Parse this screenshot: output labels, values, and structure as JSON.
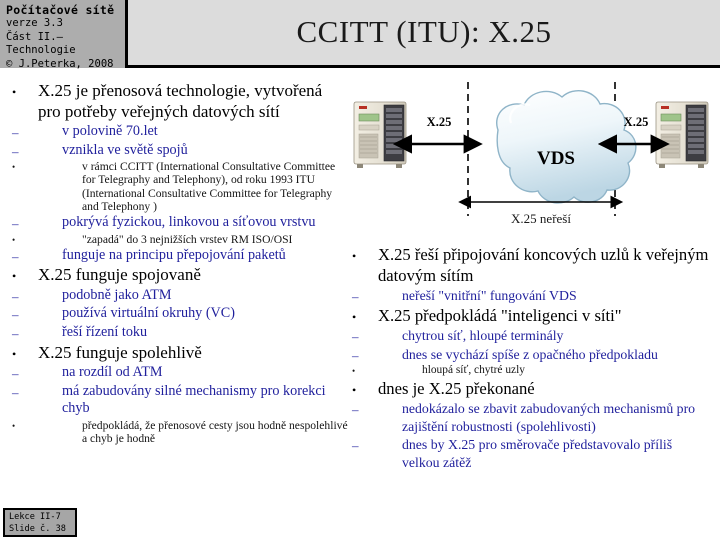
{
  "header": {
    "course_title": "Počítačové sítě",
    "version": "verze 3.3",
    "part": "Část II.–Technologie",
    "copyright": "© J.Peterka,  2008",
    "slide_title": "CCITT (ITU): X.25",
    "band_color": "#dcdcdc",
    "box_color": "#adadad"
  },
  "left_column": [
    {
      "level": 1,
      "bullet": "•",
      "text": "X.25 je přenosová technologie, vytvořená pro potřeby veřejných datových sítí"
    },
    {
      "level": 2,
      "bullet": "–",
      "text": "v polovině 70.let"
    },
    {
      "level": 2,
      "bullet": "–",
      "text": "vznikla ve světě spojů"
    },
    {
      "level": 3,
      "bullet": "•",
      "text": "v rámci CCITT (International Consultative Committee for Telegraphy and Telephony), od roku 1993 ITU (International Consultative Committee for Telegraphy and Telephony )"
    },
    {
      "level": 2,
      "bullet": "–",
      "text": "pokrývá fyzickou, linkovou a síťovou vrstvu"
    },
    {
      "level": 3,
      "bullet": "•",
      "text": "\"zapadá\" do 3 nejnižších vrstev RM ISO/OSI"
    },
    {
      "level": 2,
      "bullet": "–",
      "text": "funguje na principu přepojování paketů"
    },
    {
      "level": 1,
      "bullet": "•",
      "text": "X.25 funguje spojovaně"
    },
    {
      "level": 2,
      "bullet": "–",
      "text": "podobně jako ATM"
    },
    {
      "level": 2,
      "bullet": "–",
      "text": "používá virtuální okruhy (VC)"
    },
    {
      "level": 2,
      "bullet": "–",
      "text": "řeší řízení toku"
    },
    {
      "level": 1,
      "bullet": "•",
      "text": "X.25 funguje spolehlivě"
    },
    {
      "level": 2,
      "bullet": "–",
      "text": "na rozdíl od ATM"
    },
    {
      "level": 2,
      "bullet": "–",
      "text": "má zabudovány silné mechanismy pro korekci chyb"
    },
    {
      "level": 3,
      "bullet": "•",
      "text": "předpokládá, že přenosové cesty jsou hodně nespolehlivé a chyb je hodně"
    }
  ],
  "right_column": [
    {
      "level": 1,
      "bullet": "•",
      "text": "X.25 řeší připojování koncových uzlů k veřejným datovým sítím"
    },
    {
      "level": 2,
      "bullet": "–",
      "text": "neřeší \"vnitřní\" fungování VDS"
    },
    {
      "level": 1,
      "bullet": "•",
      "text": "X.25 předpokládá \"inteligenci v síti\""
    },
    {
      "level": 2,
      "bullet": "–",
      "text": "chytrou síť, hloupé terminály"
    },
    {
      "level": 2,
      "bullet": "–",
      "text": "dnes se vychází spíše z opačného předpokladu"
    },
    {
      "level": 3,
      "bullet": "•",
      "text": "hloupá síť, chytré uzly"
    },
    {
      "level": 1,
      "bullet": "•",
      "text": "dnes je X.25 překonané"
    },
    {
      "level": 2,
      "bullet": "–",
      "text": "nedokázalo se zbavit zabudovaných mechanismů pro zajištění robustnosti (spolehlivosti)"
    },
    {
      "level": 2,
      "bullet": "–",
      "text": "dnes by X.25 pro směrovače představovalo příliš velkou zátěž"
    }
  ],
  "diagram": {
    "cloud_label": "VDS",
    "left_link_label": "X.25",
    "right_link_label": "X.25",
    "span_label": "X.25 neřeší",
    "left_node": "server-tower",
    "right_node": "server-tower",
    "cloud_color": "#e8f2f8",
    "cloud_edge": "#8fb4c8"
  },
  "footer": {
    "lesson": "Lekce II-7",
    "slide_number": "Slide č. 38"
  },
  "colors": {
    "level1_text": "#000000",
    "level2_text": "#1f1f9c",
    "level3_text": "#141414"
  }
}
